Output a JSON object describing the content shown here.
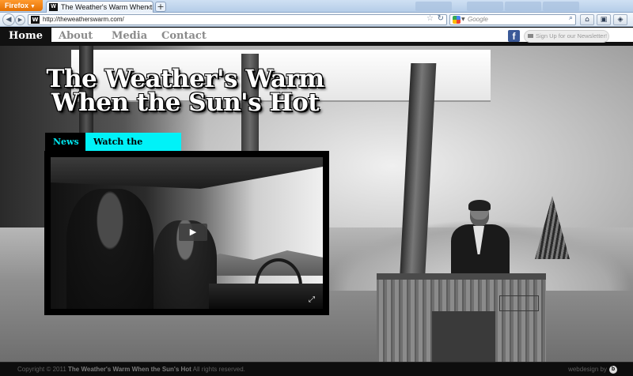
{
  "browser": {
    "app_button": "Firefox",
    "tab_title": "The Weather's Warm When the Sun's Ho...",
    "tab_close": "x",
    "new_tab": "+",
    "url": "http://theweatherswarm.com/",
    "search_placeholder": "Google",
    "favicon_letter": "W"
  },
  "site": {
    "nav": {
      "home": "Home",
      "about": "About",
      "media": "Media",
      "contact": "Contact"
    },
    "newsletter": "Sign Up for our Newsletter!",
    "facebook_letter": "f",
    "title_line1": "The Weather's Warm",
    "title_line2": "When the Sun's Hot",
    "tabs": {
      "news": "News",
      "trailer": "Watch the Trailer"
    },
    "footer": {
      "copyright_prefix": "Copyright © 2011",
      "copyright_name": "The Weather's Warm When the Sun's Hot",
      "copyright_suffix": "All rights reserved.",
      "credit": "webdesign by",
      "credit_badge": "b"
    }
  },
  "colors": {
    "accent": "#00f2f8",
    "facebook": "#3b5998",
    "firefox_orange": "#e36f00"
  }
}
